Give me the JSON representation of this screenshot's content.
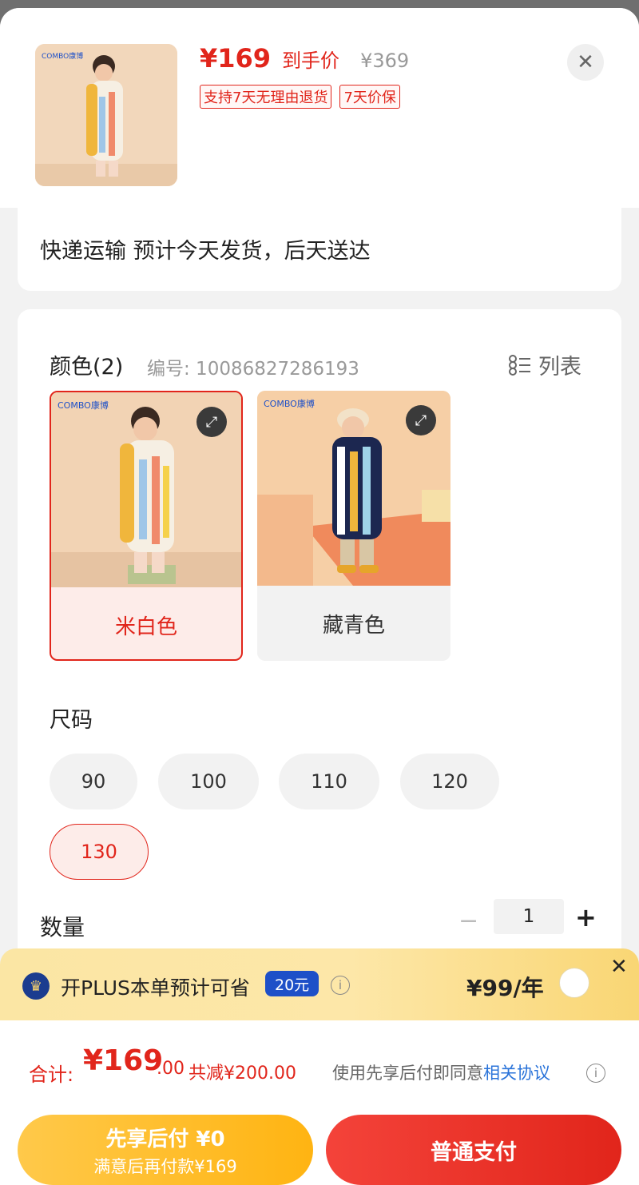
{
  "header": {
    "price": "¥169",
    "price_label": "到手价",
    "original_price": "¥369",
    "tags": [
      "支持7天无理由退货",
      "7天价保"
    ],
    "close_icon": "close-icon"
  },
  "shipping": {
    "text": "快递运输 预计今天发货，后天送达"
  },
  "color_section": {
    "title": "颜色(2)",
    "code": "编号: 10086827286193",
    "list_label": "列表",
    "options": [
      {
        "label": "米白色",
        "selected": true
      },
      {
        "label": "藏青色",
        "selected": false
      }
    ]
  },
  "size_section": {
    "title": "尺码",
    "options": [
      "90",
      "100",
      "110",
      "120",
      "130"
    ],
    "selected": "130"
  },
  "quantity": {
    "title": "数量",
    "value": "1",
    "minus": "−",
    "plus": "+"
  },
  "plus_bar": {
    "text": "开PLUS本单预计可省",
    "badge": "20元",
    "price": "¥99/年"
  },
  "total": {
    "label": "合计:",
    "amount": "¥169",
    "cents": ".00",
    "reduce": "共减¥200.00",
    "agree_text": "使用先享后付即同意",
    "agree_link": "相关协议"
  },
  "buttons": {
    "later_title": "先享后付 ¥0",
    "later_sub": "满意后再付款¥169",
    "pay": "普通支付"
  },
  "colors": {
    "accent": "#e1251b",
    "plus_blue": "#1e50c8",
    "pay_later": "#ffb412"
  }
}
